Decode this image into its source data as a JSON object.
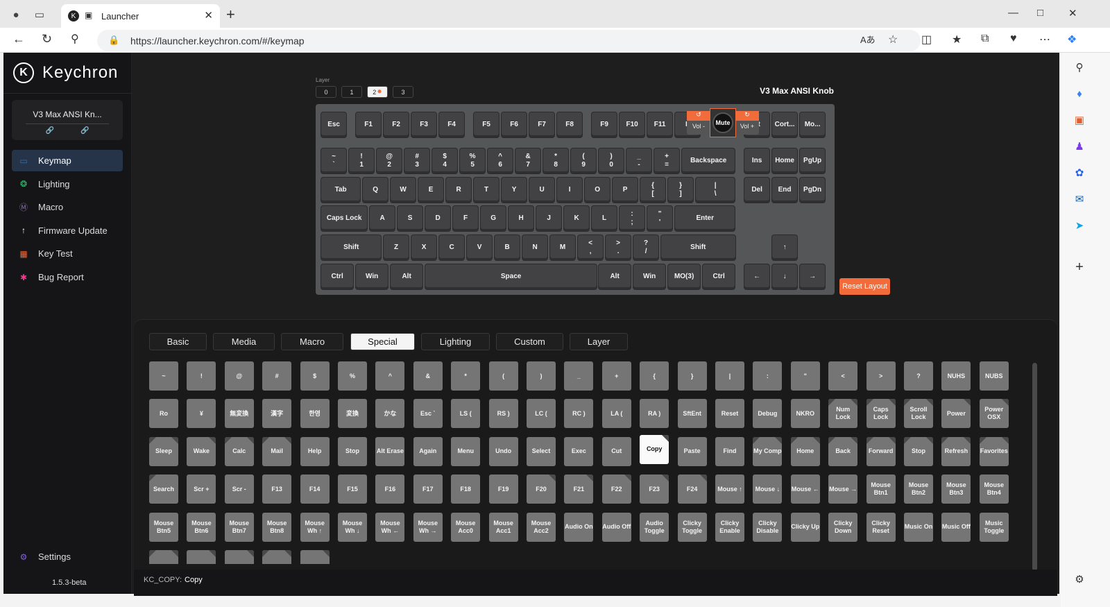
{
  "browser": {
    "tab_title": "Launcher",
    "url": "https://launcher.keychron.com/#/keymap",
    "url_host": "launcher.keychron.com",
    "url_path": "/#/keymap"
  },
  "sidebar": {
    "brand": "Keychron",
    "device_name": "V3 Max ANSI Kn...",
    "items": [
      {
        "label": "Keymap",
        "icon": "keyboard-icon",
        "color": "#3b6ea8"
      },
      {
        "label": "Lighting",
        "icon": "bulb-icon",
        "color": "#2ecc71"
      },
      {
        "label": "Macro",
        "icon": "macro-m-icon",
        "color": "#8a6fa8"
      },
      {
        "label": "Firmware Update",
        "icon": "upload-icon",
        "color": "#ffffff"
      },
      {
        "label": "Key Test",
        "icon": "test-icon",
        "color": "#f26b3a"
      },
      {
        "label": "Bug Report",
        "icon": "bug-icon",
        "color": "#e83e8c"
      }
    ],
    "settings_label": "Settings",
    "version": "1.5.3-beta"
  },
  "keyboard": {
    "layer_label": "Layer",
    "layers": [
      "0",
      "1",
      "2",
      "3"
    ],
    "active_layer": "2",
    "name": "V3 Max ANSI Knob",
    "reset_label": "Reset Layout",
    "knob": {
      "center": "Mute",
      "left": "Vol -",
      "right": "Vol +"
    }
  },
  "categories": [
    "Basic",
    "Media",
    "Macro",
    "Special",
    "Lighting",
    "Custom",
    "Layer"
  ],
  "active_category": "Special",
  "status": {
    "code": "KC_COPY:",
    "name": "Copy"
  }
}
